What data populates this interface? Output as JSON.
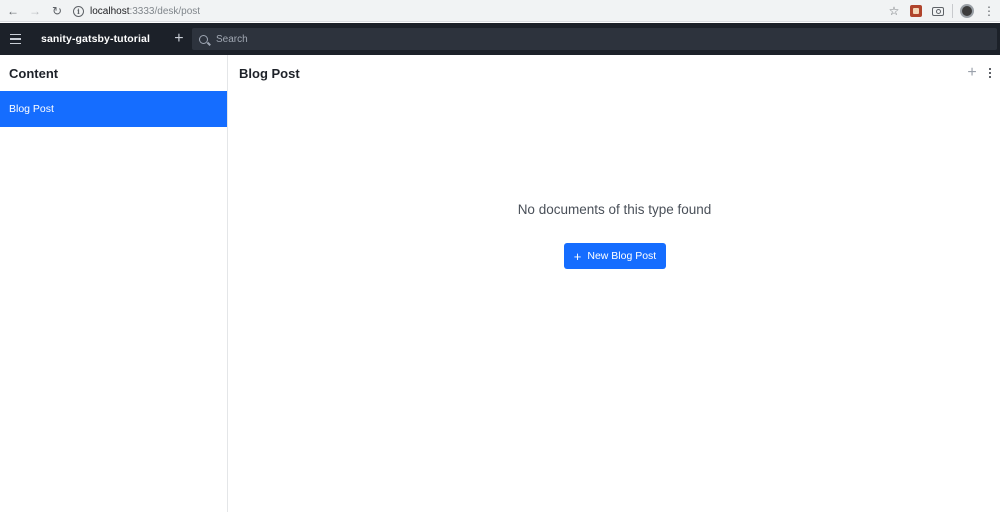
{
  "browser": {
    "url_host": "localhost",
    "url_path": ":3333/desk/post",
    "icons": [
      "back-arrow-icon",
      "forward-arrow-icon",
      "reload-icon",
      "info-icon",
      "star-icon",
      "extension-icon",
      "camera-icon",
      "profile-icon",
      "kebab-icon"
    ]
  },
  "nav": {
    "project_name": "sanity-gatsby-tutorial",
    "search_placeholder": "Search"
  },
  "left_pane": {
    "title": "Content",
    "items": [
      {
        "label": "Blog Post",
        "selected": true
      }
    ]
  },
  "right_pane": {
    "title": "Blog Post",
    "empty_message": "No documents of this type found",
    "new_button_label": "New Blog Post"
  },
  "colors": {
    "accent": "#156dff",
    "nav_bg": "#1c2129",
    "search_bg": "#2d333d"
  }
}
